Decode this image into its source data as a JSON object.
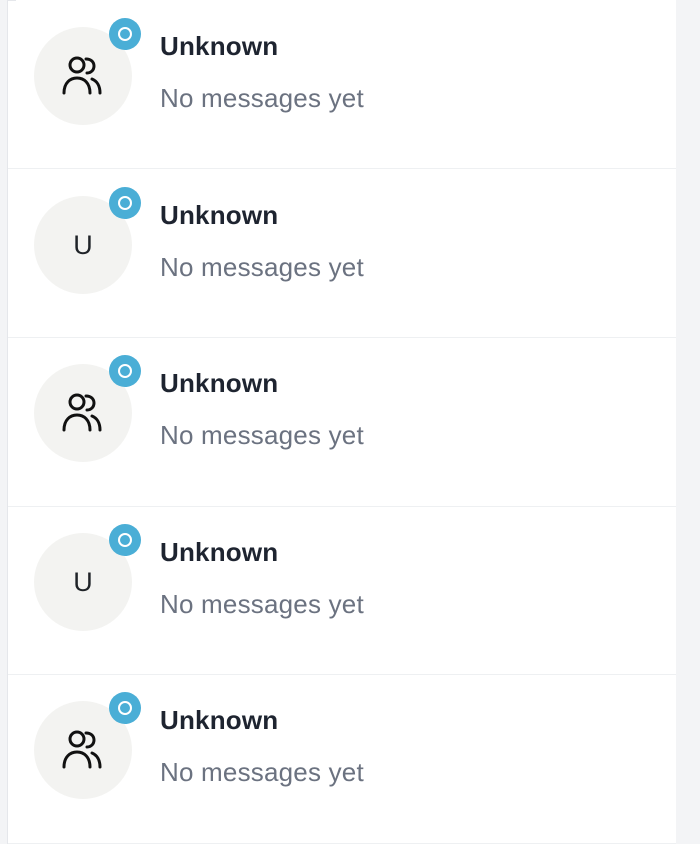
{
  "conversations": [
    {
      "name": "Unknown",
      "preview": "No messages yet",
      "avatar_type": "group",
      "avatar_icon": "users-icon",
      "avatar_letter": "",
      "badge_icon": "status-ring-icon"
    },
    {
      "name": "Unknown",
      "preview": "No messages yet",
      "avatar_type": "letter",
      "avatar_icon": "",
      "avatar_letter": "U",
      "badge_icon": "status-ring-icon"
    },
    {
      "name": "Unknown",
      "preview": "No messages yet",
      "avatar_type": "group",
      "avatar_icon": "users-icon",
      "avatar_letter": "",
      "badge_icon": "status-ring-icon"
    },
    {
      "name": "Unknown",
      "preview": "No messages yet",
      "avatar_type": "letter",
      "avatar_icon": "",
      "avatar_letter": "U",
      "badge_icon": "status-ring-icon"
    },
    {
      "name": "Unknown",
      "preview": "No messages yet",
      "avatar_type": "group",
      "avatar_icon": "users-icon",
      "avatar_letter": "",
      "badge_icon": "status-ring-icon"
    }
  ],
  "colors": {
    "badge": "#4aaed6",
    "avatar_bg": "#f3f3f1",
    "name_text": "#1e2430",
    "preview_text": "#6b7280",
    "background": "#f3f4f6"
  }
}
